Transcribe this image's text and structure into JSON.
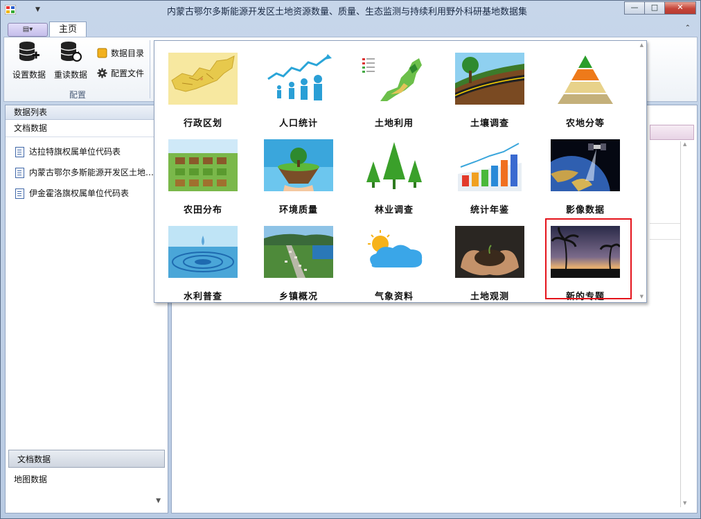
{
  "window": {
    "title": "内蒙古鄂尔多斯能源开发区土地资源数量、质量、生态监测与持续利用野外科研基地数据集",
    "minimize": "—",
    "maximize": "□",
    "close": "✕"
  },
  "ribbon": {
    "file_menu": "▤▾",
    "tabs": [
      {
        "label": "主页"
      }
    ],
    "collapse_glyph": "⌃",
    "buttons": {
      "set_data": "设置数据",
      "reload_data": "重读数据",
      "data_catalog": "数据目录",
      "config_file": "配置文件"
    },
    "group_label": "配置"
  },
  "left_panel": {
    "header": "数据列表",
    "section": "文档数据",
    "items": [
      {
        "label": "达拉特旗权属单位代码表"
      },
      {
        "label": "内蒙古鄂尔多斯能源开发区土地…"
      },
      {
        "label": "伊金霍洛旗权属单位代码表"
      }
    ],
    "nav": [
      {
        "label": "文档数据",
        "selected": true
      },
      {
        "label": "地图数据",
        "selected": false
      }
    ]
  },
  "gallery": {
    "items": [
      {
        "label": "行政区划",
        "icon": "administrative-map-icon"
      },
      {
        "label": "人口统计",
        "icon": "population-icon"
      },
      {
        "label": "土地利用",
        "icon": "land-use-map-icon"
      },
      {
        "label": "土壤调查",
        "icon": "soil-layers-icon"
      },
      {
        "label": "农地分等",
        "icon": "pyramid-icon"
      },
      {
        "label": "农田分布",
        "icon": "farmland-icon"
      },
      {
        "label": "环境质量",
        "icon": "floating-island-icon"
      },
      {
        "label": "林业调查",
        "icon": "trees-icon"
      },
      {
        "label": "统计年鉴",
        "icon": "bar-chart-icon"
      },
      {
        "label": "影像数据",
        "icon": "satellite-icon"
      },
      {
        "label": "水利普查",
        "icon": "water-drop-icon"
      },
      {
        "label": "乡镇概况",
        "icon": "town-aerial-icon"
      },
      {
        "label": "气象资料",
        "icon": "weather-icon"
      },
      {
        "label": "土地观测",
        "icon": "soil-hands-icon"
      },
      {
        "label": "新的专题",
        "icon": "palm-sunset-icon",
        "highlighted": true
      }
    ]
  },
  "colors": {
    "highlight": "#e4131b",
    "window_frame": "#c7d6ea"
  }
}
